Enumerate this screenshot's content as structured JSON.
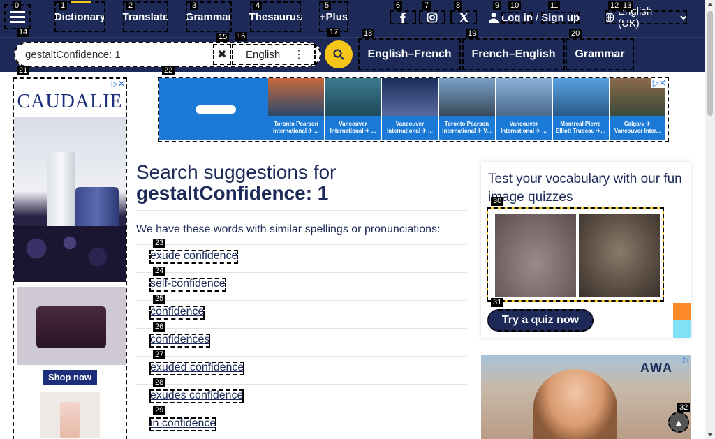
{
  "nav": {
    "links": [
      {
        "label": "Dictionary",
        "active": true
      },
      {
        "label": "Translate"
      },
      {
        "label": "Grammar"
      },
      {
        "label": "Thesaurus"
      },
      {
        "label": "+Plus"
      }
    ],
    "social": [
      "facebook-icon",
      "instagram-icon",
      "x-icon"
    ],
    "login": "Log in",
    "separator": "/",
    "signup": "Sign up",
    "language": "English (UK)"
  },
  "search": {
    "value": "gestaltConfidence: 1",
    "dictionary": "English"
  },
  "sublinks": [
    "English–French",
    "French–English",
    "Grammar"
  ],
  "left_ad": {
    "brand": "CAUDALIE",
    "cta": "Shop now"
  },
  "top_ad": {
    "tiles": [
      {
        "caption": "Toronto Pearson International ✈ ...",
        "c1": "#c7683d",
        "c2": "#2b4a6b"
      },
      {
        "caption": "Vancouver International ✈ ...",
        "c1": "#3e7a8f",
        "c2": "#1e4a5a"
      },
      {
        "caption": "Vancouver International ✈ ...",
        "c1": "#1a2f5a",
        "c2": "#5a6aa0"
      },
      {
        "caption": "Toronto Pearson International ✈ V...",
        "c1": "#7aa0c8",
        "c2": "#3a4a5a"
      },
      {
        "caption": "Vancouver International ✈ ...",
        "c1": "#8ab0d8",
        "c2": "#4a6a8a"
      },
      {
        "caption": "Montreal Pierre Elliott Trudeau ✈...",
        "c1": "#5aa0e0",
        "c2": "#2a5a8a"
      },
      {
        "caption": "Calgary ✈ Vancouver Inter...",
        "c1": "#8a6a4a",
        "c2": "#3a4a3a"
      }
    ]
  },
  "main": {
    "heading_prefix": "Search suggestions for",
    "query": "gestaltConfidence: 1",
    "intro": "We have these words with similar spellings or pronunciations:",
    "suggestions": [
      "exude confidence",
      "self-confidence",
      "confidence",
      "confidences",
      "exuded confidence",
      "exudes confidence",
      "in confidence"
    ]
  },
  "quiz": {
    "title": "Test your vocabulary with our fun image quizzes",
    "button": "Try a quiz now"
  },
  "video_ad": {
    "text": "AWA"
  },
  "tags": [
    "0",
    "1",
    "2",
    "3",
    "4",
    "5",
    "6",
    "7",
    "8",
    "9",
    "10",
    "11",
    "12",
    "13",
    "14",
    "15",
    "16",
    "17",
    "18",
    "19",
    "20",
    "21",
    "22",
    "23",
    "24",
    "25",
    "26",
    "27",
    "28",
    "29",
    "30",
    "31",
    "32"
  ],
  "colors": {
    "navy": "#1d2a57",
    "accent": "#f5c518",
    "ad_blue": "#1a7ad6"
  }
}
